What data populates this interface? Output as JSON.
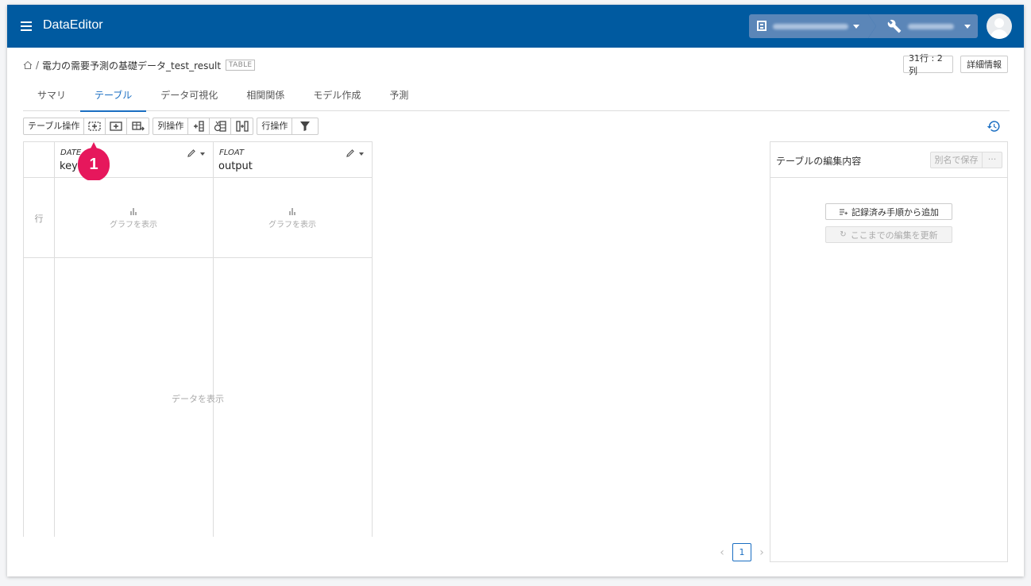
{
  "app": {
    "title": "DataEditor"
  },
  "header": {
    "org_icon": "building-icon",
    "project_icon": "wrench-icon",
    "avatar_icon": "user-avatar-icon"
  },
  "breadcrumb": {
    "home_icon": "home-icon",
    "separator": "/",
    "table_name": "電力の需要予測の基礎データ_test_result",
    "badge": "TABLE"
  },
  "info": {
    "shape": "31行 : 2列",
    "details": "詳細情報"
  },
  "tabs": [
    {
      "label": "サマリ",
      "active": false
    },
    {
      "label": "テーブル",
      "active": true
    },
    {
      "label": "データ可視化",
      "active": false
    },
    {
      "label": "相関関係",
      "active": false
    },
    {
      "label": "モデル作成",
      "active": false
    },
    {
      "label": "予測",
      "active": false
    }
  ],
  "toolbar": {
    "table_ops_label": "テーブル操作",
    "col_ops_label": "列操作",
    "row_ops_label": "行操作"
  },
  "grid": {
    "row_label": "行",
    "columns": [
      {
        "type": "DATE",
        "name": "key",
        "graph_label": "グラフを表示"
      },
      {
        "type": "FLOAT",
        "name": "output",
        "graph_label": "グラフを表示"
      }
    ],
    "data_placeholder": "データを表示"
  },
  "panel": {
    "title": "テーブルの編集内容",
    "save_as": "別名で保存",
    "more": "···",
    "add_from_recorded": "記録済み手順から追加",
    "update_edits": "ここまでの編集を更新"
  },
  "pagination": {
    "current": "1"
  },
  "callout": {
    "number": "1",
    "color": "#e6175c"
  },
  "colors": {
    "header_bg": "#005aa0",
    "accent": "#1a6ec2"
  }
}
